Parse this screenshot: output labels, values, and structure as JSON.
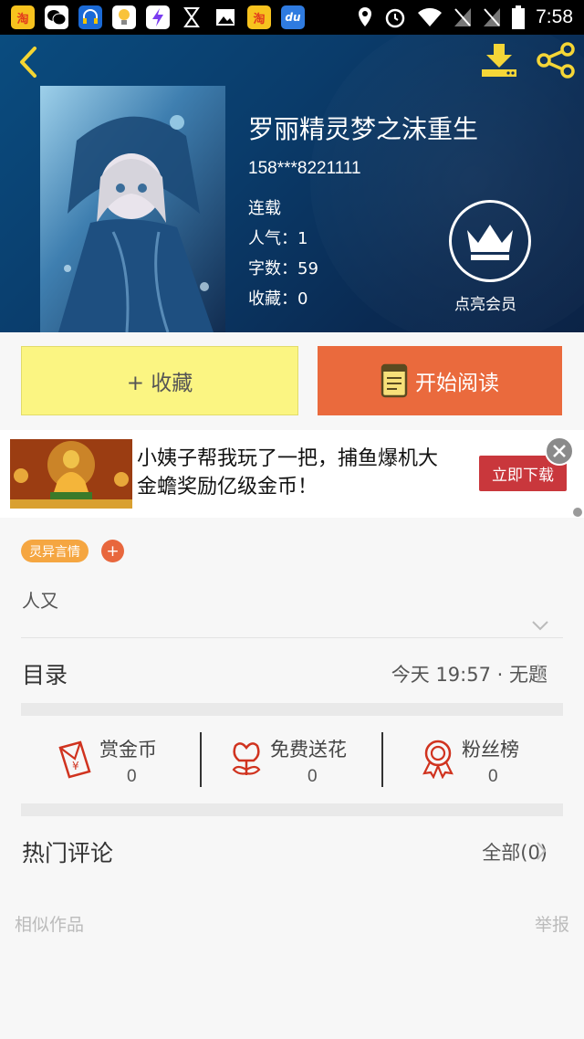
{
  "status_bar": {
    "time": "7:58",
    "app_icons": [
      "taobao-icon",
      "wechat-icon",
      "headset-icon",
      "bulb-icon",
      "lightning-icon",
      "hourglass-icon",
      "image-icon",
      "taobao-icon",
      "du-icon"
    ],
    "du_text": "du",
    "status_icons": [
      "location-icon",
      "alarm-icon",
      "wifi-icon",
      "no-sim-icon",
      "no-sim-icon",
      "battery-icon"
    ]
  },
  "book": {
    "title": "罗丽精灵梦之沫重生",
    "author": "158***8221111",
    "status": "连载",
    "popularity": "人气：1",
    "word_count": "字数：59",
    "favorites": "收藏：0",
    "vip_label": "点亮会员"
  },
  "actions": {
    "collect_label": "+ 收藏",
    "read_label": "开始阅读"
  },
  "ad": {
    "text": "小姨子帮我玩了一把，捕鱼爆机大金蟾奖励亿级金币！",
    "download_label": "立即下载"
  },
  "tags": {
    "items": [
      "灵异言情"
    ],
    "add_label": "+"
  },
  "description": "人又",
  "catalog": {
    "label": "目录",
    "latest": "今天 19:57 · 无题"
  },
  "stats": {
    "reward": {
      "label": "赏金币",
      "value": "0"
    },
    "flowers": {
      "label": "免费送花",
      "value": "0"
    },
    "fans": {
      "label": "粉丝榜",
      "value": "0"
    }
  },
  "comments": {
    "label": "热门评论",
    "all_label": "全部(0)"
  },
  "footer": {
    "similar_label": "相似作品",
    "report_label": "举报"
  },
  "colors": {
    "header_bg": "#0a3c6b",
    "collect_bg": "#fbf582",
    "read_bg": "#ea6a3d",
    "accent_red": "#c9373c",
    "tag_orange": "#f5a641",
    "icon_yellow": "#f5d532"
  }
}
